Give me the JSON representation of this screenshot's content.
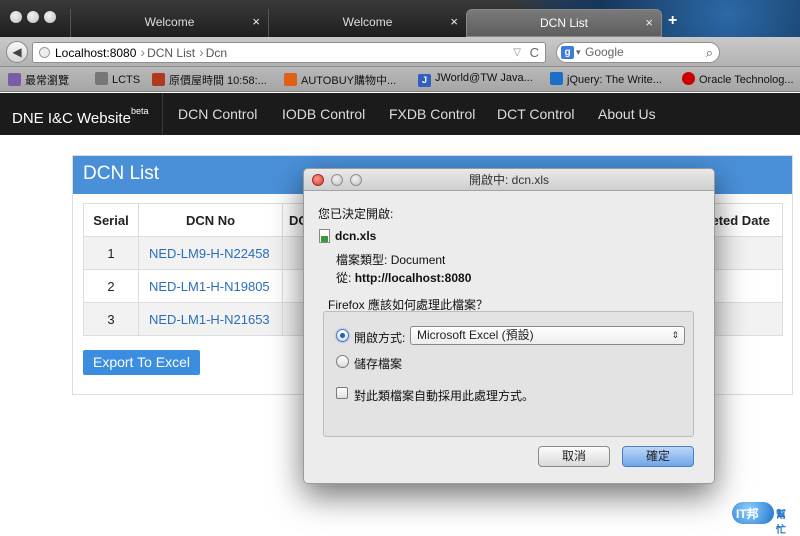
{
  "browser": {
    "tabs": [
      {
        "label": "Welcome",
        "close": "×"
      },
      {
        "label": "Welcome",
        "close": "×"
      },
      {
        "label": "DCN List",
        "close": "×"
      }
    ],
    "new_tab": "+",
    "back": "◀",
    "url_crumbs": [
      "Localhost:8080",
      "DCN List",
      "Dcn"
    ],
    "url_dropdown": "▽",
    "reload": "C",
    "search_engine": "g",
    "search_placeholder": "Google",
    "search_icon": "⌕"
  },
  "bookmarks": [
    {
      "label": "最常瀏覽",
      "icon": "folder-icon",
      "color": "#7a5ca8"
    },
    {
      "label": "LCTS",
      "icon": "grid-icon",
      "color": "#777777"
    },
    {
      "label": "原價屋時間 10:58:...",
      "icon": "shop-icon",
      "color": "#b23a1c"
    },
    {
      "label": "AUTOBUY購物中...",
      "icon": "autobuy-icon",
      "color": "#e0601a"
    },
    {
      "label": "JWorld@TW Java...",
      "icon": "j-icon",
      "color": "#2f5fbf"
    },
    {
      "label": "jQuery: The Write...",
      "icon": "jquery-icon",
      "color": "#1b6fc6"
    },
    {
      "label": "Oracle Technolog...",
      "icon": "oracle-icon",
      "color": "#cc0000"
    }
  ],
  "site": {
    "brand": "DNE I&C Website",
    "brand_sup": "beta",
    "nav": [
      "DCN Control",
      "IODB Control",
      "FXDB Control",
      "DCT Control",
      "About Us"
    ]
  },
  "panel": {
    "title": "DCN List",
    "columns": [
      "Serial",
      "DCN No",
      "DC",
      "eted Date"
    ],
    "rows": [
      {
        "serial": "1",
        "dcn": "NED-LM9-H-N22458"
      },
      {
        "serial": "2",
        "dcn": "NED-LM1-H-N19805"
      },
      {
        "serial": "3",
        "dcn": "NED-LM1-H-N21653"
      }
    ],
    "export_label": "Export To Excel"
  },
  "dialog": {
    "title": "開啟中: dcn.xls",
    "heading": "您已決定開啟:",
    "filename": "dcn.xls",
    "type_label": "檔案類型:",
    "type_value": "Document",
    "from_label": "從:",
    "from_value": "http://localhost:8080",
    "question": "Firefox 應該如何處理此檔案？",
    "open_with_label": "開啟方式:",
    "app_value": "Microsoft Excel (預設)",
    "app_arrow": "⇕",
    "save_label": "儲存檔案",
    "remember_label": "對此類檔案自動採用此處理方式。",
    "cancel": "取消",
    "ok": "確定"
  },
  "watermark": {
    "text1": "IT邦",
    "text2": "幫忙"
  }
}
